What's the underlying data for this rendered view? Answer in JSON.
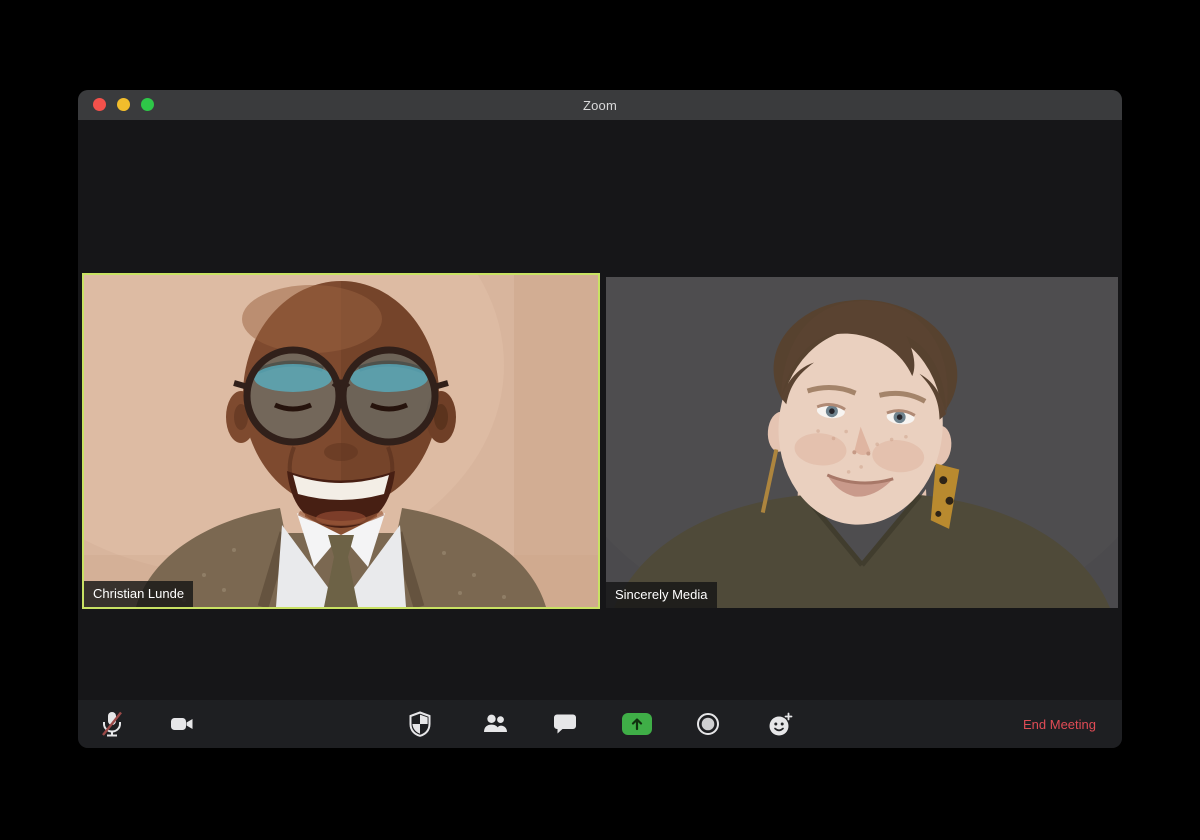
{
  "window": {
    "title": "Zoom"
  },
  "traffic_lights": {
    "close_color": "#f4514b",
    "minimize_color": "#f2bd2c",
    "maximize_color": "#2ec748"
  },
  "tiles": [
    {
      "name": "Christian Lunde",
      "active_speaker": true
    },
    {
      "name": "Sincerely Media",
      "active_speaker": false
    }
  ],
  "toolbar": {
    "buttons": [
      {
        "id": "mute",
        "icon": "microphone-muted-icon"
      },
      {
        "id": "video",
        "icon": "video-camera-icon"
      },
      {
        "id": "security",
        "icon": "security-shield-icon"
      },
      {
        "id": "participants",
        "icon": "participants-icon"
      },
      {
        "id": "chat",
        "icon": "chat-bubble-icon"
      },
      {
        "id": "share-screen",
        "icon": "share-screen-icon"
      },
      {
        "id": "record",
        "icon": "record-icon"
      },
      {
        "id": "reactions",
        "icon": "reactions-icon"
      }
    ],
    "end_meeting_label": "End Meeting"
  },
  "colors": {
    "window_bg": "#161618",
    "titlebar_bg": "#3a3b3d",
    "toolbar_bg": "#1e1f22",
    "active_speaker_border": "#c9e263",
    "share_green": "#3fae47",
    "end_meeting_red": "#e04b55",
    "mute_slash_red": "#9c4a49"
  }
}
